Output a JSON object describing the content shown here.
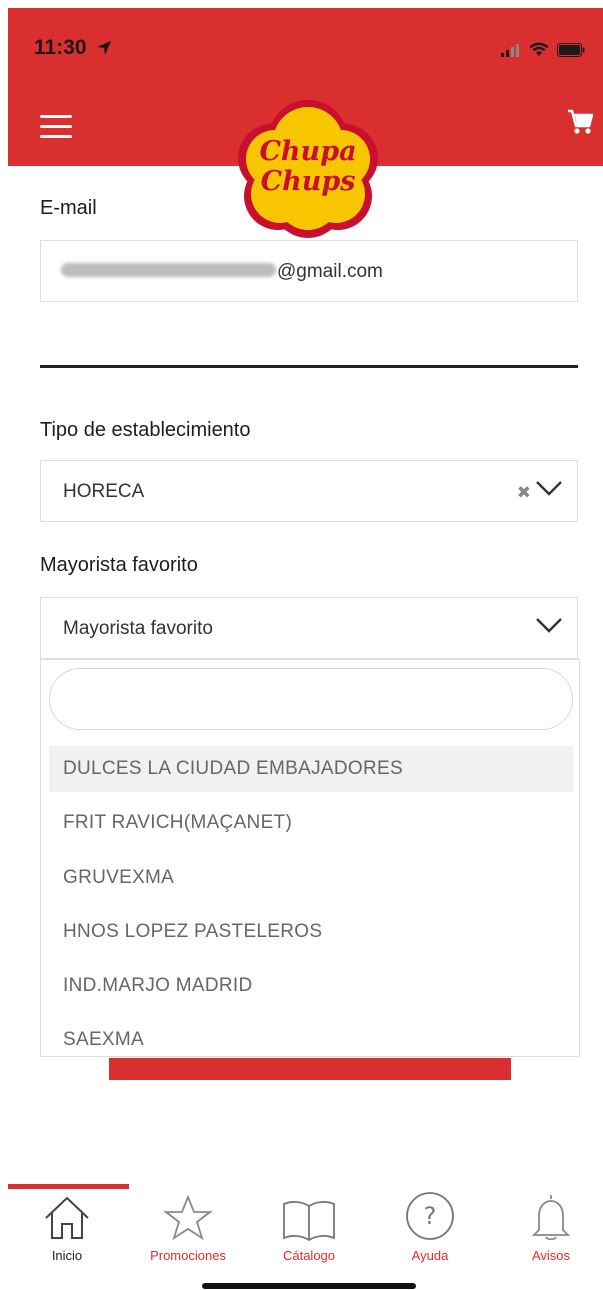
{
  "status_bar": {
    "time": "11:30"
  },
  "header": {
    "logo_line1": "Chupa",
    "logo_line2": "Chups",
    "colors": {
      "brand_red": "#d9302f",
      "logo_yellow": "#f7c600",
      "logo_text_red": "#c8102e"
    }
  },
  "email": {
    "label": "E-mail",
    "value_visible": "@gmail.com"
  },
  "establishment": {
    "label": "Tipo de establecimiento",
    "value": "HORECA",
    "clear_glyph": "✖"
  },
  "wholesaler": {
    "label": "Mayorista favorito",
    "placeholder": "Mayorista favorito",
    "options": [
      "DULCES LA CIUDAD EMBAJADORES",
      "FRIT RAVICH(MAÇANET)",
      "GRUVEXMA",
      "HNOS LOPEZ PASTELEROS",
      "IND.MARJO MADRID",
      "SAEXMA"
    ]
  },
  "tabbar": {
    "tabs": [
      {
        "label": "Inicio",
        "icon": "home-icon"
      },
      {
        "label": "Promociones",
        "icon": "star-icon"
      },
      {
        "label": "Cátalogo",
        "icon": "book-icon"
      },
      {
        "label": "Ayuda",
        "icon": "help-icon"
      },
      {
        "label": "Avisos",
        "icon": "bell-icon"
      }
    ],
    "help_glyph": "?"
  }
}
